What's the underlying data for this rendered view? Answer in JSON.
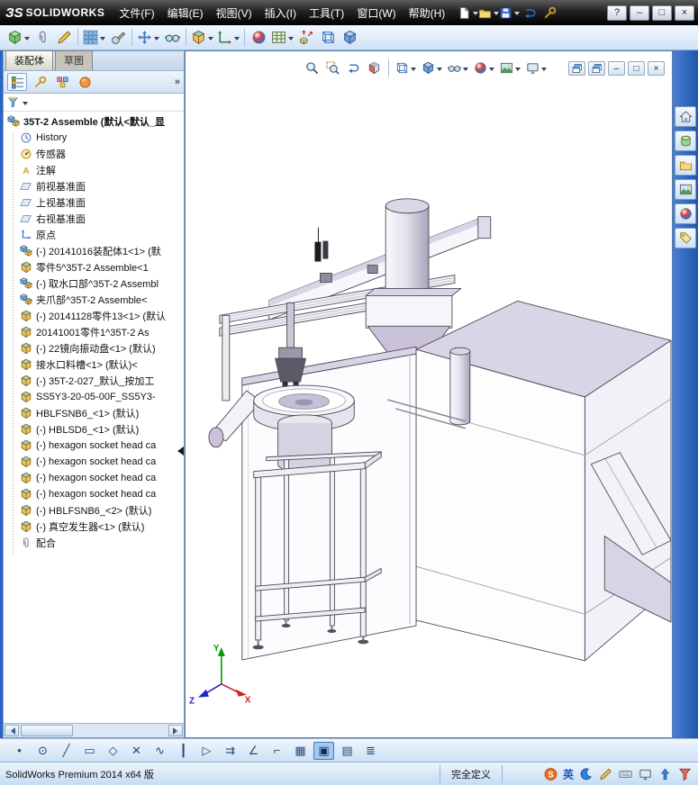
{
  "titlebar": {
    "logo_prefix": "ЗS",
    "brand": "SOLIDWORKS",
    "menus": [
      "文件(F)",
      "编辑(E)",
      "视图(V)",
      "插入(I)",
      "工具(T)",
      "窗口(W)",
      "帮助(H)"
    ],
    "quick_access": [
      {
        "name": "new-document-icon",
        "sprite": "s-page",
        "caret": true
      },
      {
        "name": "open-document-icon",
        "sprite": "s-folder",
        "caret": true
      },
      {
        "name": "save-icon",
        "sprite": "s-floppy",
        "caret": true
      },
      {
        "name": "undo-icon",
        "sprite": "s-prevview"
      },
      {
        "name": "options-icon",
        "sprite": "s-pm"
      }
    ],
    "window_controls": [
      {
        "name": "help-button",
        "glyph": "?"
      },
      {
        "name": "minimize-button",
        "glyph": "–"
      },
      {
        "name": "restore-button",
        "glyph": "□"
      },
      {
        "name": "close-button",
        "glyph": "×"
      }
    ]
  },
  "command_tabs": {
    "assembly": "装配体",
    "sketch": "草图"
  },
  "panel": {
    "more_glyph": "»",
    "manager_tabs": [
      {
        "name": "featuremanager-tab-icon",
        "sprite": "s-fmtree",
        "active": true
      },
      {
        "name": "propertymanager-tab-icon",
        "sprite": "s-pm"
      },
      {
        "name": "configurationmanager-tab-icon",
        "sprite": "s-cm"
      },
      {
        "name": "displaymanager-tab-icon",
        "sprite": "s-dm"
      }
    ]
  },
  "feature_tree": {
    "root": "35T-2 Assemble (默认<默认_显",
    "items": [
      {
        "label": "History",
        "icon": "history-icon"
      },
      {
        "label": "传感器",
        "icon": "sensors-icon"
      },
      {
        "label": "注解",
        "icon": "annotations-icon"
      },
      {
        "label": "前视基准面",
        "icon": "plane-icon"
      },
      {
        "label": "上视基准面",
        "icon": "plane-icon"
      },
      {
        "label": "右视基准面",
        "icon": "plane-icon"
      },
      {
        "label": "原点",
        "icon": "origin-icon"
      },
      {
        "label": "(-) 20141016装配体1<1> (默",
        "icon": "assembly-icon"
      },
      {
        "label": "零件5^35T-2 Assemble<1",
        "icon": "part-icon"
      },
      {
        "label": "(-) 取水口部^35T-2 Assembl",
        "icon": "assembly-icon"
      },
      {
        "label": "夹爪部^35T-2 Assemble<",
        "icon": "assembly-icon"
      },
      {
        "label": "(-) 20141128零件13<1> (默认",
        "icon": "part-icon"
      },
      {
        "label": "20141001零件1^35T-2 As",
        "icon": "part-icon"
      },
      {
        "label": "(-) 22镜向振动盘<1> (默认)",
        "icon": "part-icon"
      },
      {
        "label": "接水口料槽<1> (默认)<",
        "icon": "part-icon"
      },
      {
        "label": "(-) 35T-2-027_默认_按加工",
        "icon": "part-icon"
      },
      {
        "label": "SS5Y3-20-05-00F_SS5Y3-",
        "icon": "part-icon"
      },
      {
        "label": "HBLFSNB6_<1> (默认)",
        "icon": "part-icon"
      },
      {
        "label": "(-) HBLSD6_<1> (默认)",
        "icon": "part-icon"
      },
      {
        "label": "(-) hexagon socket head ca",
        "icon": "part-icon"
      },
      {
        "label": "(-) hexagon socket head ca",
        "icon": "part-icon"
      },
      {
        "label": "(-) hexagon socket head ca",
        "icon": "part-icon"
      },
      {
        "label": "(-) hexagon socket head ca",
        "icon": "part-icon"
      },
      {
        "label": "(-) HBLFSNB6_<2> (默认)",
        "icon": "part-icon"
      },
      {
        "label": "(-) 真空发生器<1> (默认)",
        "icon": "part-icon"
      },
      {
        "label": "配合",
        "icon": "mates-icon"
      }
    ]
  },
  "icons": {
    "sprite_map": {
      "history-icon": "s-clock",
      "sensors-icon": "s-gauge",
      "annotations-icon": "s-A",
      "plane-icon": "s-plane",
      "origin-icon": "s-origin",
      "part-icon": "s-cube",
      "assembly-icon": "s-asm",
      "mates-icon": "s-clip"
    }
  },
  "toolbars": {
    "assembly": [
      {
        "name": "insert-components-icon",
        "sprite": "s-cube-g",
        "caret": true
      },
      {
        "name": "mate-icon",
        "sprite": "s-clip"
      },
      {
        "name": "edit-component-icon",
        "sprite": "s-pencil"
      },
      {
        "name": "separator"
      },
      {
        "name": "linear-component-pattern-icon",
        "sprite": "s-grid",
        "caret": true
      },
      {
        "name": "smart-fasteners-icon",
        "sprite": "s-bolt"
      },
      {
        "name": "separator"
      },
      {
        "name": "move-component-icon",
        "sprite": "s-arrows",
        "caret": true
      },
      {
        "name": "show-hidden-components-icon",
        "sprite": "s-glasses"
      },
      {
        "name": "separator"
      },
      {
        "name": "assembly-features-icon",
        "sprite": "s-cube",
        "caret": true
      },
      {
        "name": "reference-geometry-icon",
        "sprite": "s-axis",
        "caret": true
      },
      {
        "name": "separator"
      },
      {
        "name": "new-motion-study-icon",
        "sprite": "s-ball"
      },
      {
        "name": "bill-of-materials-icon",
        "sprite": "s-table",
        "caret": true
      },
      {
        "name": "exploded-view-icon",
        "sprite": "s-explode"
      },
      {
        "name": "interference-detection-icon",
        "sprite": "s-wirecube"
      },
      {
        "name": "instant3d-icon",
        "sprite": "s-cube-b"
      }
    ],
    "heads_up": [
      {
        "name": "zoom-fit-icon",
        "sprite": "s-magnifier"
      },
      {
        "name": "zoom-area-icon",
        "sprite": "s-magarea"
      },
      {
        "name": "previous-view-icon",
        "sprite": "s-prevview"
      },
      {
        "name": "section-view-icon",
        "sprite": "s-section"
      },
      {
        "name": "separator"
      },
      {
        "name": "view-orientation-icon",
        "sprite": "s-wirecube",
        "caret": true
      },
      {
        "name": "display-style-icon",
        "sprite": "s-cube-b",
        "caret": true
      },
      {
        "name": "hide-show-items-icon",
        "sprite": "s-glasses",
        "caret": true
      },
      {
        "name": "edit-appearance-icon",
        "sprite": "s-ball",
        "caret": true
      },
      {
        "name": "apply-scene-icon",
        "sprite": "s-photo",
        "caret": true
      },
      {
        "name": "view-settings-icon",
        "sprite": "s-monitor",
        "caret": true
      }
    ],
    "mdi": [
      {
        "name": "mdi-cascade-icon",
        "sprite": "s-windows"
      },
      {
        "name": "mdi-tile-icon",
        "sprite": "s-windows"
      },
      {
        "name": "mdi-minimize-button",
        "glyph": "–"
      },
      {
        "name": "mdi-restore-button",
        "glyph": "□"
      },
      {
        "name": "mdi-close-button",
        "glyph": "×"
      }
    ],
    "task_pane": [
      {
        "name": "solidworks-resources-icon",
        "sprite": "s-home"
      },
      {
        "name": "design-library-icon",
        "sprite": "s-cyl"
      },
      {
        "name": "file-explorer-icon",
        "sprite": "s-folder"
      },
      {
        "name": "view-palette-icon",
        "sprite": "s-photo"
      },
      {
        "name": "appearances-scenes-icon",
        "sprite": "s-ball"
      },
      {
        "name": "custom-properties-icon",
        "sprite": "s-tag"
      }
    ],
    "sketch": [
      {
        "name": "point-tool-icon",
        "glyph": "•"
      },
      {
        "name": "circle-tool-icon",
        "glyph": "⊙"
      },
      {
        "name": "line-tool-icon",
        "glyph": "╱"
      },
      {
        "name": "rectangle-tool-icon",
        "glyph": "▭"
      },
      {
        "name": "polygon-tool-icon",
        "glyph": "◇"
      },
      {
        "name": "trim-tool-icon",
        "glyph": "✕"
      },
      {
        "name": "spline-tool-icon",
        "glyph": "∿"
      },
      {
        "name": "centerline-tool-icon",
        "glyph": "┃"
      },
      {
        "name": "mirror-tool-icon",
        "glyph": "▷"
      },
      {
        "name": "offset-tool-icon",
        "glyph": "⇉"
      },
      {
        "name": "angle-tool-icon",
        "glyph": "∠"
      },
      {
        "name": "convert-entities-icon",
        "glyph": "⌐"
      },
      {
        "name": "grid-tool-icon",
        "glyph": "▦"
      },
      {
        "name": "sketch-tool-icon",
        "glyph": "▣",
        "active": true
      },
      {
        "name": "plane-tool-icon",
        "glyph": "▤"
      },
      {
        "name": "ruler-tool-icon",
        "glyph": "≣"
      }
    ],
    "status_icons": [
      {
        "name": "quick-tips-icon",
        "sprite": "s-moon"
      },
      {
        "name": "annotation-pen-icon",
        "sprite": "s-pencil"
      },
      {
        "name": "keyboard-icon",
        "sprite": "s-keyboard"
      },
      {
        "name": "monitor-icon",
        "sprite": "s-monitor"
      },
      {
        "name": "publish-icon",
        "sprite": "s-uparrow"
      },
      {
        "name": "filter-icon",
        "sprite": "s-funnel-r"
      }
    ]
  },
  "statusbar": {
    "left": "SolidWorks Premium 2014 x64 版",
    "definition_state": "完全定义",
    "ime": "英"
  },
  "viewport": {
    "triad": {
      "x": "X",
      "y": "Y",
      "z": "Z"
    }
  },
  "colors": {
    "frame_blue": "#2a64c8",
    "model_lavender": "#d9d3e6",
    "toolbar_top": "#f3f8fe",
    "toolbar_bottom": "#cfe2f6"
  }
}
